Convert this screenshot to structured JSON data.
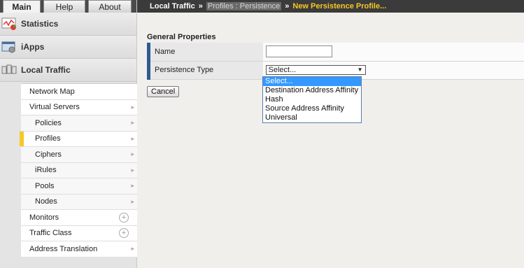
{
  "tabs": [
    {
      "label": "Main",
      "active": true
    },
    {
      "label": "Help",
      "active": false
    },
    {
      "label": "About",
      "active": false
    }
  ],
  "sections": {
    "statistics": "Statistics",
    "iapps": "iApps",
    "local_traffic": "Local Traffic"
  },
  "menu": [
    {
      "label": "Network Map"
    },
    {
      "label": "Virtual Servers"
    },
    {
      "label": "Policies"
    },
    {
      "label": "Profiles"
    },
    {
      "label": "Ciphers"
    },
    {
      "label": "iRules"
    },
    {
      "label": "Pools"
    },
    {
      "label": "Nodes"
    },
    {
      "label": "Monitors"
    },
    {
      "label": "Traffic Class"
    },
    {
      "label": "Address Translation"
    }
  ],
  "breadcrumb": {
    "root": "Local Traffic",
    "sep": "»",
    "link": "Profiles : Persistence",
    "current": "New Persistence Profile..."
  },
  "form": {
    "title": "General Properties",
    "name_label": "Name",
    "name_value": "",
    "type_label": "Persistence Type",
    "type_selected": "Select..."
  },
  "dropdown": {
    "options": [
      "Select...",
      "Destination Address Affinity",
      "Hash",
      "Source Address Affinity",
      "Universal"
    ],
    "highlighted": "Select..."
  },
  "cancel_label": "Cancel",
  "colors": {
    "accent_yellow": "#f6c825",
    "row_accent": "#2f5a8f",
    "highlight": "#3399ff"
  }
}
